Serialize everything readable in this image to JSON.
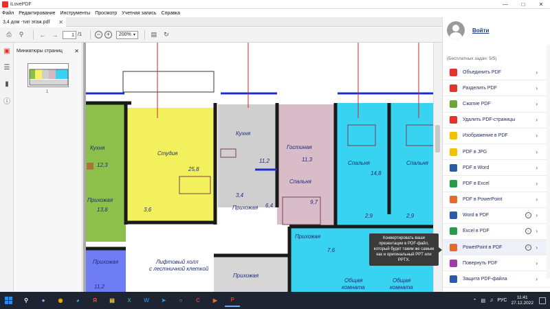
{
  "window": {
    "title": "iLovePDF"
  },
  "menu": [
    "Файл",
    "Редактирование",
    "Инструменты",
    "Просмотр",
    "Учетная запись",
    "Справка"
  ],
  "tab": {
    "label": "3,4 дом -тип этаж.pdf"
  },
  "toolbar": {
    "page_value": "1",
    "page_total": "/1",
    "zoom": "200%"
  },
  "thumbnails": {
    "title": "Миниатюры страниц",
    "page_number": "1"
  },
  "account": {
    "login_label": "Войти",
    "free_tasks": "(Бесплатных задач: 5/5)"
  },
  "tools": [
    {
      "label": "Объединить PDF",
      "color": "#e5322d",
      "globe": false
    },
    {
      "label": "Разделить PDF",
      "color": "#e5322d",
      "globe": false
    },
    {
      "label": "Сжатие PDF",
      "color": "#6ba539",
      "globe": false
    },
    {
      "label": "Удалить PDF-страницы",
      "color": "#e5322d",
      "globe": false
    },
    {
      "label": "Изображение в PDF",
      "color": "#f2c200",
      "globe": false
    },
    {
      "label": "PDF в JPG",
      "color": "#f2c200",
      "globe": false
    },
    {
      "label": "PDF в Word",
      "color": "#2a5aa8",
      "globe": false
    },
    {
      "label": "PDF в Excel",
      "color": "#2c9a4a",
      "globe": false
    },
    {
      "label": "PDF в PowerPoint",
      "color": "#e46b2b",
      "globe": false
    },
    {
      "label": "Word в PDF",
      "color": "#2a5aa8",
      "globe": true
    },
    {
      "label": "Excel в PDF",
      "color": "#2c9a4a",
      "globe": true
    },
    {
      "label": "PowerPoint в PDF",
      "color": "#e46b2b",
      "globe": true
    },
    {
      "label": "Повернуть PDF",
      "color": "#9b3fa6",
      "globe": false
    },
    {
      "label": "Защита PDF-файла",
      "color": "#2a5aa8",
      "globe": false
    }
  ],
  "tooltip": "Конвертировать ваши презентации в PDF-файл, который будет таким же самым как и оригинальный PPT или PPTX.",
  "plan": {
    "rooms": [
      "Кухня",
      "12,3",
      "Прихожая",
      "13,8",
      "Прихожая",
      "Студия",
      "25,8",
      "3,6",
      "Кухня",
      "11,2",
      "Прихожая",
      "3,4",
      "6,4",
      "Гостиная",
      "11,3",
      "Спальня",
      "9,7",
      "Лифтовый холл",
      "с лестничной клеткой",
      "Прихожая",
      "Прихожая",
      "7,6",
      "Спальня",
      "14,8",
      "Спальня",
      "2,9",
      "2,9",
      "Общая",
      "комната",
      "Общая",
      "комната",
      "11,2"
    ]
  },
  "taskbar": {
    "lang": "РУС",
    "time": "11:41",
    "date": "27.12.2022"
  }
}
